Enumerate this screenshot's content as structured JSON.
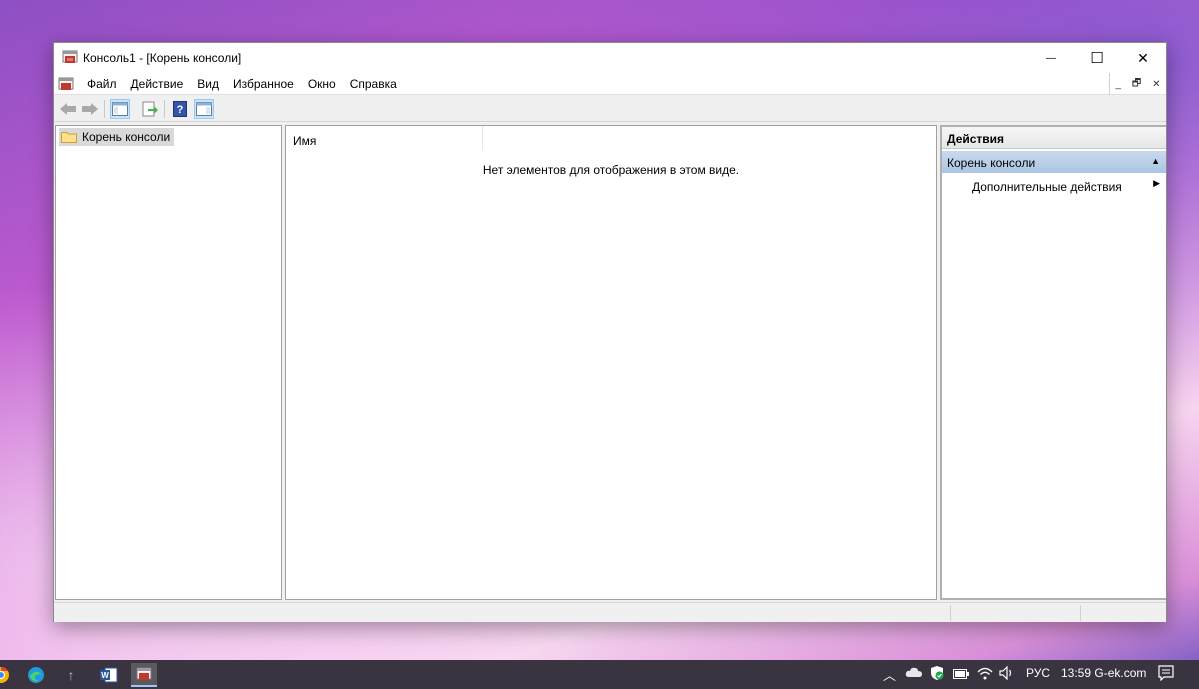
{
  "window": {
    "title": "Консоль1 - [Корень консоли]",
    "controls": {
      "minimize": "—",
      "maximize": "☐",
      "close": "✕"
    }
  },
  "menubar": {
    "items": [
      "Файл",
      "Действие",
      "Вид",
      "Избранное",
      "Окно",
      "Справка"
    ],
    "mdi": {
      "minimize": "_",
      "restore": "🗗",
      "close": "✕"
    }
  },
  "toolbar": {
    "buttons": [
      "back-icon",
      "forward-icon",
      "show-hide-tree-icon",
      "export-list-icon",
      "help-icon",
      "show-action-pane-icon"
    ]
  },
  "tree": {
    "items": [
      {
        "label": "Корень консоли",
        "icon": "folder-icon"
      }
    ]
  },
  "list": {
    "columns": [
      "Имя"
    ],
    "empty_message": "Нет элементов для отображения в этом виде."
  },
  "actions": {
    "title": "Действия",
    "section": "Корень консоли",
    "items": [
      "Дополнительные действия"
    ]
  },
  "taskbar": {
    "apps": [
      "chrome-icon",
      "edge-icon",
      "upload-icon",
      "word-icon",
      "mmc-icon"
    ],
    "tray": {
      "language": "РУС",
      "clock": "13:59 G-ek.com"
    }
  },
  "colors": {
    "window_bg": "#f0f0f0",
    "actions_section": "#adc5e3",
    "taskbar": "#3a3340"
  }
}
